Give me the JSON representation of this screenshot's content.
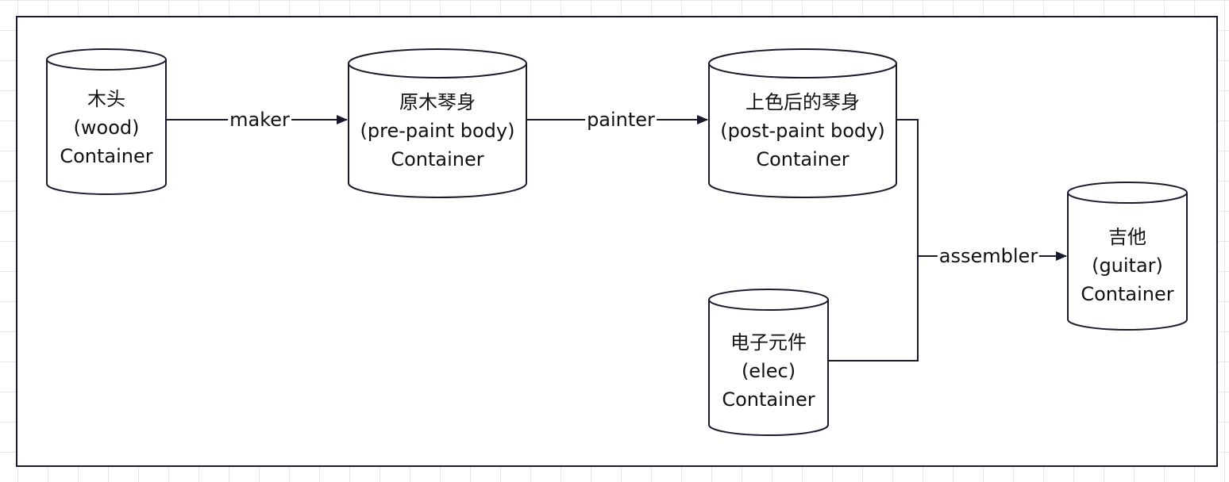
{
  "nodes": [
    {
      "id": "wood",
      "name": "wood-container",
      "lines": [
        "木头",
        "(wood)",
        "Container"
      ]
    },
    {
      "id": "prepaint",
      "name": "pre-paint-body-container",
      "lines": [
        "原木琴身",
        "(pre-paint body)",
        "Container"
      ]
    },
    {
      "id": "postpaint",
      "name": "post-paint-body-container",
      "lines": [
        "上色后的琴身",
        "(post-paint body)",
        "Container"
      ]
    },
    {
      "id": "elec",
      "name": "elec-container",
      "lines": [
        "电子元件",
        "(elec)",
        "Container"
      ]
    },
    {
      "id": "guitar",
      "name": "guitar-container",
      "lines": [
        "吉他",
        "(guitar)",
        "Container"
      ]
    }
  ],
  "edges": [
    {
      "id": "maker",
      "label": "maker"
    },
    {
      "id": "painter",
      "label": "painter"
    },
    {
      "id": "assembler",
      "label": "assembler"
    }
  ],
  "colors": {
    "stroke": "#1a1a2e",
    "text": "#111111",
    "grid": "#e6e6e6",
    "background": "#ffffff"
  }
}
